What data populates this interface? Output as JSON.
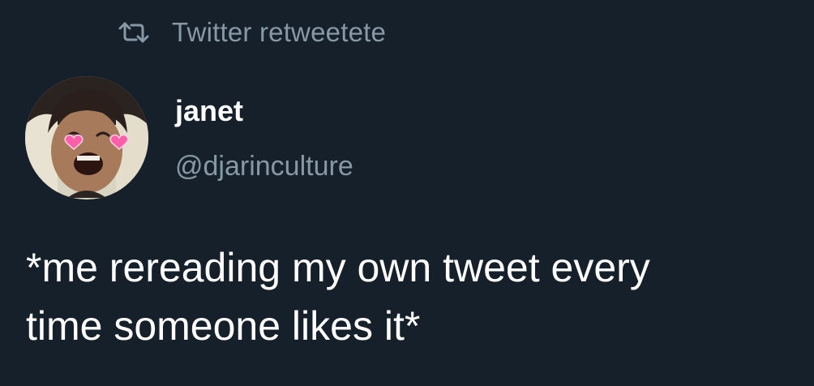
{
  "retweet": {
    "icon": "retweet-icon",
    "label": "Twitter retweetete"
  },
  "author": {
    "avatar_icon": "avatar-photo",
    "display_name": "janet",
    "handle": "@djarinculture"
  },
  "tweet": {
    "line1": "*me rereading my own tweet every",
    "line2": "time someone likes it*"
  },
  "colors": {
    "background": "#15202b",
    "primary_text": "#ffffff",
    "secondary_text": "#8899a6"
  }
}
